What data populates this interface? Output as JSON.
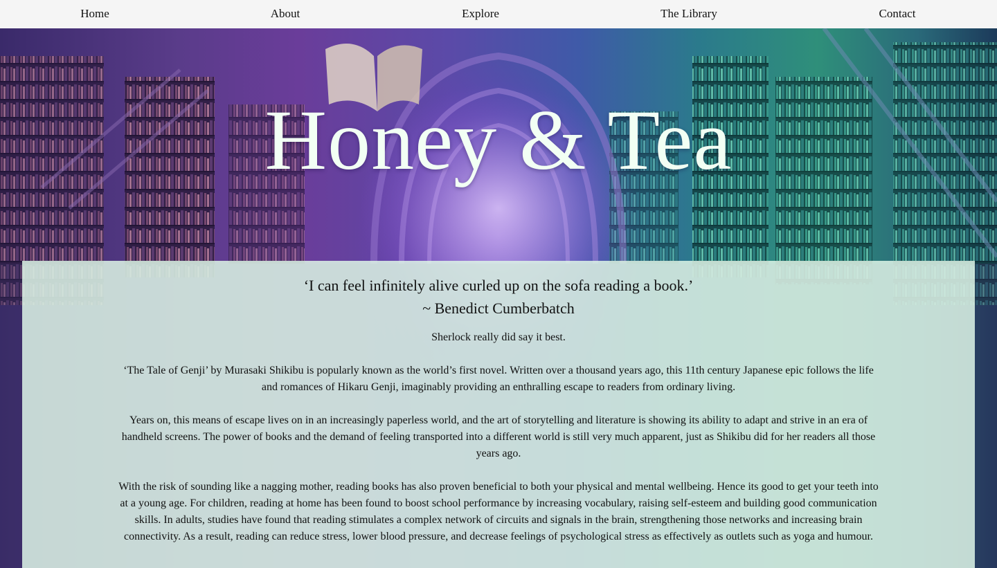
{
  "nav": {
    "items": [
      {
        "label": "Home"
      },
      {
        "label": "About"
      },
      {
        "label": "Explore"
      },
      {
        "label": "The Library"
      },
      {
        "label": "Contact"
      }
    ]
  },
  "hero": {
    "title": "Honey & Tea"
  },
  "quote": {
    "text": "‘I can feel infinitely alive curled up on the sofa reading a book.’",
    "author": "~ Benedict Cumberbatch"
  },
  "content": {
    "paragraphs": [
      "Sherlock really did say it best.",
      "‘The Tale of Genji’ by Murasaki Shikibu is popularly known as the world’s first novel. Written over a thousand years ago, this 11th century Japanese epic follows the life and romances of Hikaru Genji, imaginably providing an enthralling escape to readers from ordinary living.",
      "Years on, this means of escape lives on in an increasingly paperless world, and the art of storytelling and literature is showing its ability to adapt and strive in an era of handheld screens. The power of books and the demand of feeling transported into a different world is still very much apparent, just as Shikibu did for her readers all those years ago.",
      "With the risk of sounding like a nagging mother, reading books has also proven beneficial to both your physical and mental wellbeing. Hence its good to get your teeth into at a young age. For children, reading at home has been found to boost school performance by increasing vocabulary, raising self-esteem and building good communication skills. In adults, studies have found that reading stimulates a complex network of circuits and signals in the brain, strengthening those networks and increasing brain connectivity. As a result, reading can reduce stress, lower blood pressure, and decrease feelings of psychological stress as effectively as outlets such as yoga and humour."
    ]
  },
  "colors": {
    "nav_bg": "#f5f5f5",
    "title": "#f2fff4",
    "panel_bg": "#ddf4e7"
  }
}
